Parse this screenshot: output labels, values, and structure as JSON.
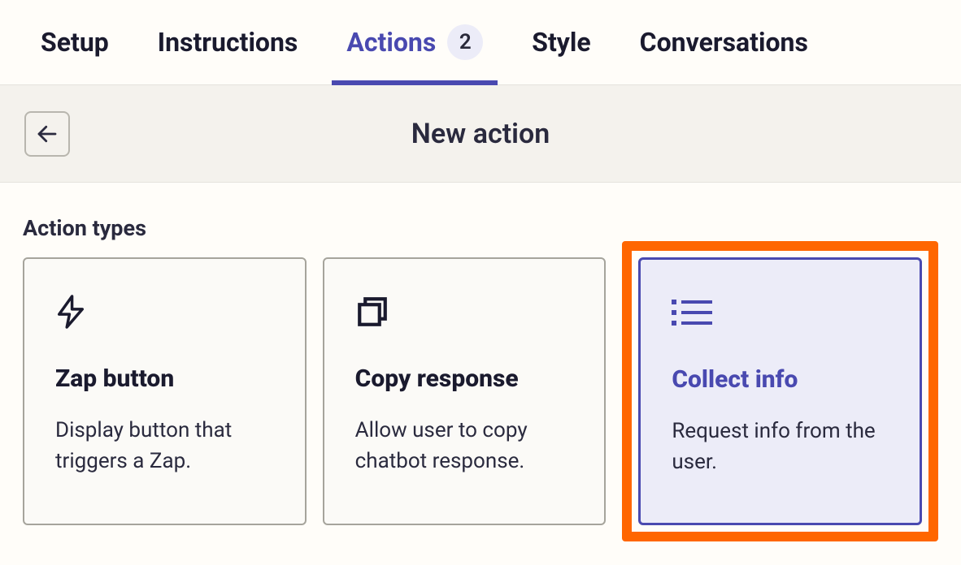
{
  "tabs": [
    {
      "label": "Setup",
      "badge": null,
      "active": false
    },
    {
      "label": "Instructions",
      "badge": null,
      "active": false
    },
    {
      "label": "Actions",
      "badge": "2",
      "active": true
    },
    {
      "label": "Style",
      "badge": null,
      "active": false
    },
    {
      "label": "Conversations",
      "badge": null,
      "active": false
    }
  ],
  "subheader": {
    "title": "New action"
  },
  "section": {
    "title": "Action types"
  },
  "cards": [
    {
      "icon": "lightning-icon",
      "title": "Zap button",
      "desc": "Display button that triggers a Zap.",
      "selected": false,
      "highlighted": false
    },
    {
      "icon": "copy-icon",
      "title": "Copy response",
      "desc": "Allow user to copy chatbot response.",
      "selected": false,
      "highlighted": false
    },
    {
      "icon": "list-icon",
      "title": "Collect info",
      "desc": "Request info from the user.",
      "selected": true,
      "highlighted": true
    }
  ]
}
